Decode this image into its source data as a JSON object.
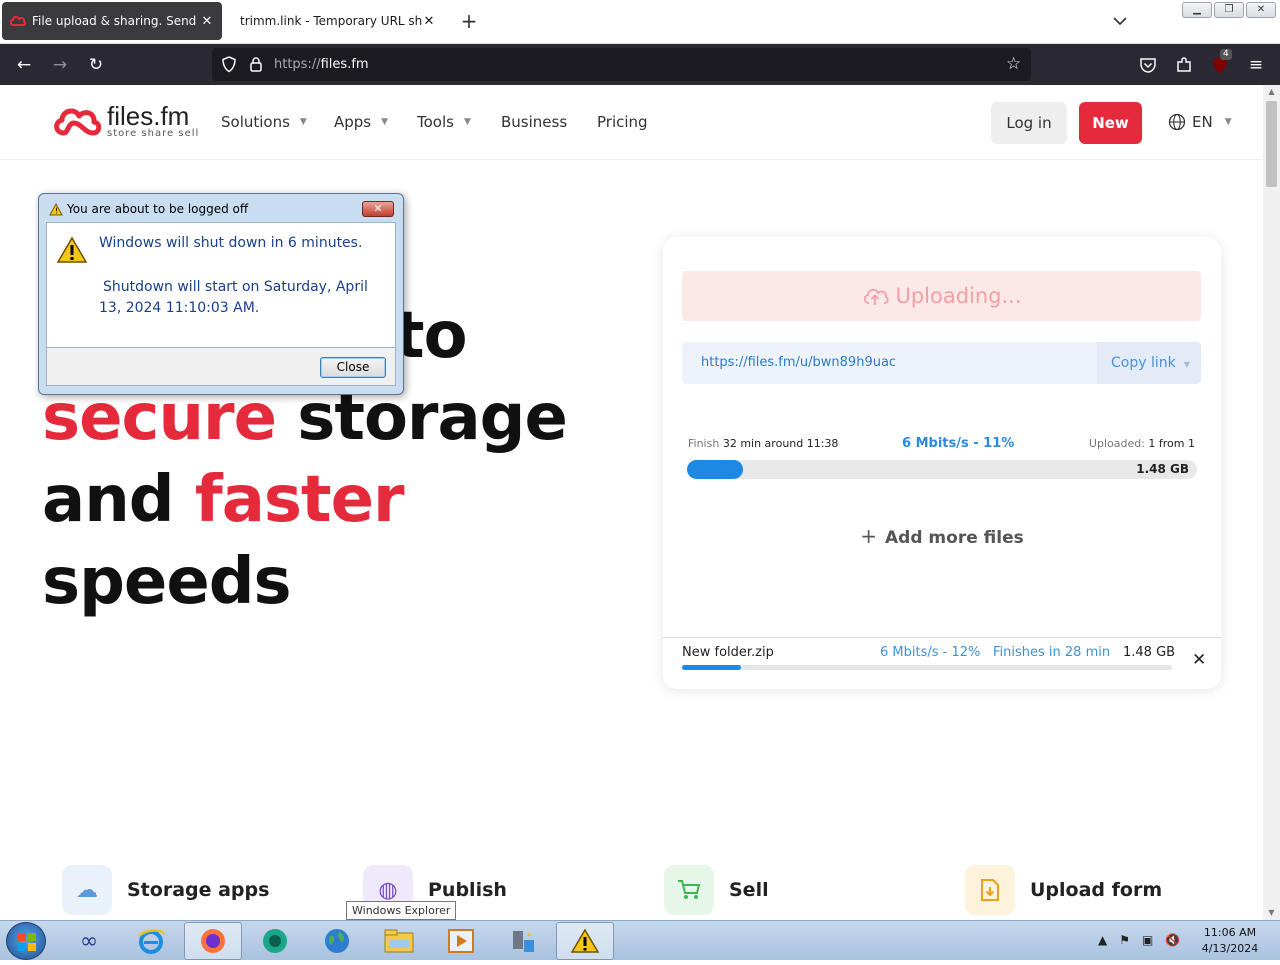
{
  "browser": {
    "tabs": [
      {
        "title": "File upload & sharing. Send large",
        "active": true
      },
      {
        "title": "trimm.link - Temporary URL shorter",
        "active": false
      }
    ],
    "url_scheme": "https://",
    "url_host": "files.fm",
    "extension_badge": "4"
  },
  "site": {
    "logo_name": "files.fm",
    "logo_tagline": "store share sell",
    "menu": [
      {
        "label": "Solutions",
        "dropdown": true
      },
      {
        "label": "Apps",
        "dropdown": true
      },
      {
        "label": "Tools",
        "dropdown": true
      },
      {
        "label": "Business",
        "dropdown": false
      },
      {
        "label": "Pricing",
        "dropdown": false
      }
    ],
    "login_label": "Log in",
    "new_label": "New",
    "lang_label": "EN"
  },
  "hero": {
    "line1_tail": "to",
    "line2_red": "secure",
    "line2_rest": "storage",
    "line3_plain": "and",
    "line3_red": "faster",
    "line4": "speeds"
  },
  "upload": {
    "status": "Uploading...",
    "share_link": "https://files.fm/u/bwn89h9uac",
    "copy_link_label": "Copy link",
    "finish_label": "Finish",
    "finish_value": "32 min around 11:38",
    "speed": "6 Mbits/s - 11%",
    "uploaded_label": "Uploaded:",
    "uploaded_value": "1 from 1",
    "progress_percent": 11,
    "total_size": "1.48 GB",
    "add_more_label": "Add more files",
    "file": {
      "name": "New folder.zip",
      "speed": "6 Mbits/s - 12%",
      "finishes": "Finishes in 28 min",
      "size": "1.48 GB",
      "progress_percent": 12
    }
  },
  "features": [
    {
      "label": "Storage apps",
      "icon": "cloud-sync-icon",
      "color": "#e9f2fb"
    },
    {
      "label": "Publish",
      "icon": "globe-icon",
      "color": "#f0e8fb"
    },
    {
      "label": "Sell",
      "icon": "cart-icon",
      "color": "#e6f7ea"
    },
    {
      "label": "Upload form",
      "icon": "upload-file-icon",
      "color": "#fdf3dc"
    }
  ],
  "dialog": {
    "title": "You are about to be logged off",
    "message1": "Windows will shut down in 6 minutes.",
    "message2": "Shutdown will start on Saturday, April 13, 2024 11:10:03 AM.",
    "close_label": "Close"
  },
  "taskbar": {
    "tooltip": "Windows Explorer",
    "time": "11:06 AM",
    "date": "4/13/2024"
  },
  "colors": {
    "brand_red": "#e52a3b",
    "accent_blue": "#1e88e5",
    "browser_dark": "#2b2a33"
  }
}
